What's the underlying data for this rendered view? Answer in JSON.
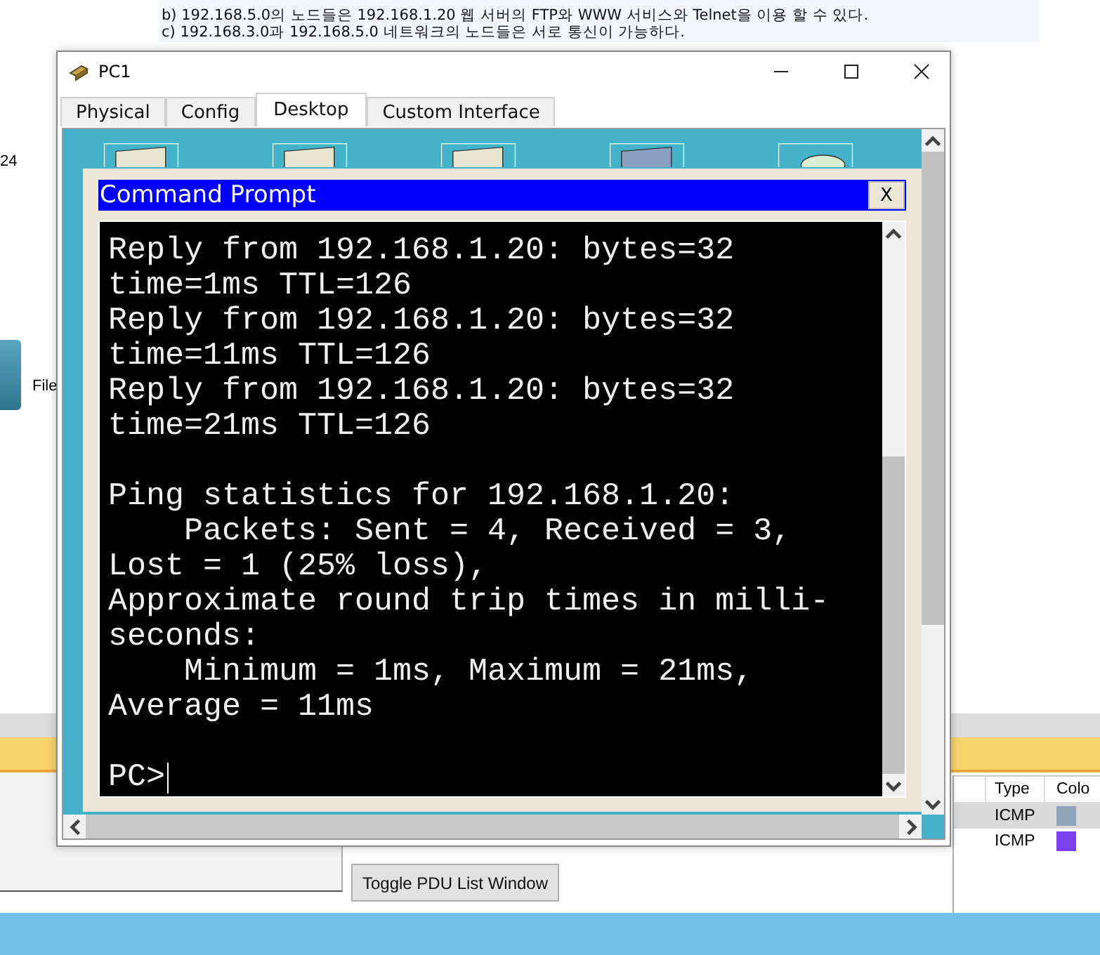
{
  "notes": [
    "b) 192.168.5.0의 노드들은 192.168.1.20 웹 서버의 FTP와 WWW 서비스와 Telnet을 이용 할 수 있다.",
    "c) 192.168.3.0과 192.168.5.0 네트워크의 노드들은 서로 통신이 가능하다."
  ],
  "canvas_labels": [
    "24",
    "File"
  ],
  "window": {
    "title": "PC1",
    "tabs": [
      {
        "label": "Physical",
        "selected": false
      },
      {
        "label": "Config",
        "selected": false
      },
      {
        "label": "Desktop",
        "selected": true
      },
      {
        "label": "Custom Interface",
        "selected": false
      }
    ]
  },
  "command_prompt": {
    "title": "Command Prompt",
    "close": "X",
    "blocks": [
      [
        "Reply from 192.168.1.20: bytes=32",
        "time=1ms TTL=126",
        "Reply from 192.168.1.20: bytes=32",
        "time=11ms TTL=126",
        "Reply from 192.168.1.20: bytes=32",
        "time=21ms TTL=126"
      ],
      [
        "Ping statistics for 192.168.1.20:",
        "    Packets: Sent = 4, Received = 3,",
        "Lost = 1 (25% loss),",
        "Approximate round trip times in milli-",
        "seconds:",
        "    Minimum = 1ms, Maximum = 21ms,",
        "Average = 11ms"
      ]
    ],
    "prompt": "PC>"
  },
  "pdu_table": {
    "columns": [
      "Type",
      "Colo"
    ],
    "rows": [
      {
        "type": "ICMP",
        "color": "#8fa3b8",
        "selected": true
      },
      {
        "type": "ICMP",
        "color": "#7b3ff0",
        "selected": false
      }
    ]
  },
  "toggle_button": "Toggle PDU List Window"
}
